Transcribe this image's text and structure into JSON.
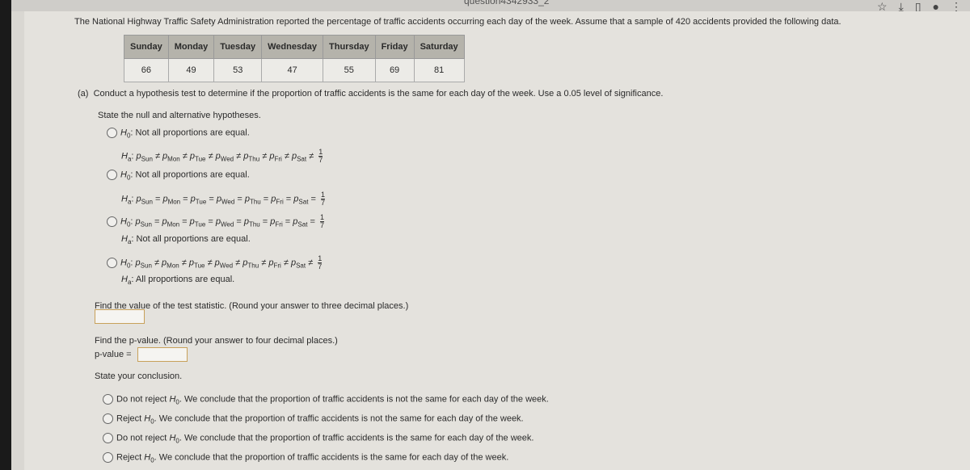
{
  "browser": {
    "url_fragment": "question4342933_2",
    "icons": [
      "star-icon",
      "download-icon",
      "sidebar-icon",
      "profile-avatar",
      "more-icon"
    ]
  },
  "intro": "The National Highway Traffic Safety Administration reported the percentage of traffic accidents occurring each day of the week. Assume that a sample of 420 accidents provided the following data.",
  "table": {
    "headers": [
      "Sunday",
      "Monday",
      "Tuesday",
      "Wednesday",
      "Thursday",
      "Friday",
      "Saturday"
    ],
    "values": [
      "66",
      "49",
      "53",
      "47",
      "55",
      "69",
      "81"
    ]
  },
  "part_a": {
    "label": "(a)",
    "prompt": "Conduct a hypothesis test to determine if the proportion of traffic accidents is the same for each day of the week. Use a 0.05 level of significance.",
    "hyp_prompt": "State the null and alternative hypotheses.",
    "options": [
      {
        "h0": "Not all proportions are equal.",
        "ha_rel": "≠"
      },
      {
        "h0": "Not all proportions are equal.",
        "ha_rel": "="
      },
      {
        "h0_rel": "=",
        "ha": "Not all proportions are equal."
      },
      {
        "h0_rel": "≠",
        "ha": "All proportions are equal."
      }
    ],
    "days": [
      "Sun",
      "Mon",
      "Tue",
      "Wed",
      "Thu",
      "Fri",
      "Sat"
    ],
    "frac_num": "1",
    "frac_den": "7",
    "stat_prompt": "Find the value of the test statistic. (Round your answer to three decimal places.)",
    "test_statistic": "",
    "p_prompt": "Find the p-value. (Round your answer to four decimal places.)",
    "p_label": "p-value =",
    "p_value": "",
    "conclusion_prompt": "State your conclusion.",
    "conclusions": [
      {
        "action": "Do not reject",
        "text": ". We conclude that the proportion of traffic accidents is not the same for each day of the week."
      },
      {
        "action": "Reject",
        "text": ". We conclude that the proportion of traffic accidents is not the same for each day of the week."
      },
      {
        "action": "Do not reject",
        "text": ". We conclude that the proportion of traffic accidents is the same for each day of the week."
      },
      {
        "action": "Reject",
        "text": ". We conclude that the proportion of traffic accidents is the same for each day of the week."
      }
    ]
  }
}
